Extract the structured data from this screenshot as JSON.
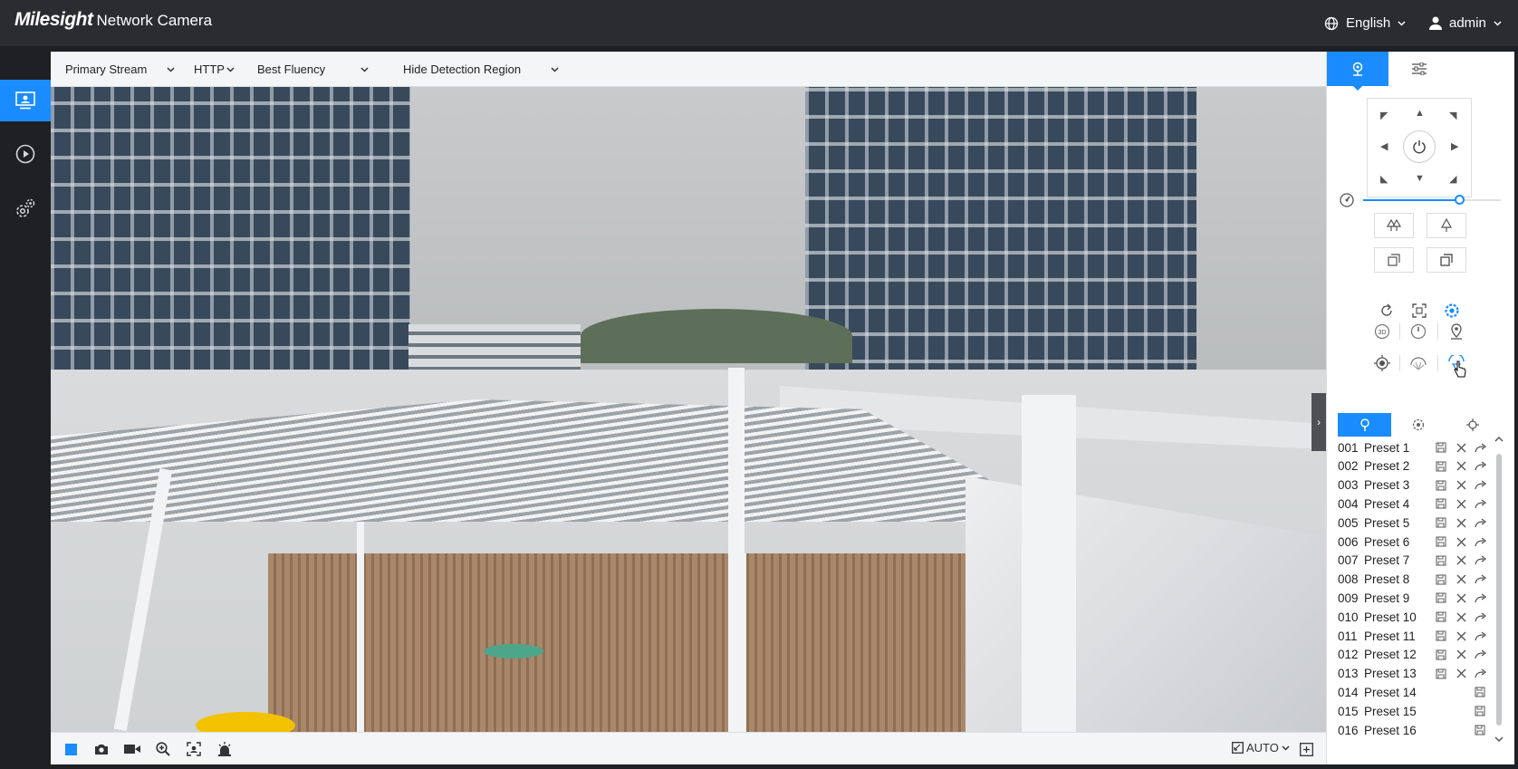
{
  "header": {
    "brand": "Milesight",
    "product": "Network Camera",
    "language": "English",
    "user": "admin"
  },
  "sidebar": {
    "items": [
      {
        "name": "live-view",
        "icon": "monitor-icon",
        "active": true
      },
      {
        "name": "playback",
        "icon": "play-icon",
        "active": false
      },
      {
        "name": "settings",
        "icon": "gear-icon",
        "active": false
      }
    ]
  },
  "toolbar": {
    "stream": "Primary Stream",
    "protocol": "HTTP",
    "fluency": "Best Fluency",
    "detection": "Hide Detection Region"
  },
  "bottom": {
    "icons": [
      "stop-icon",
      "snapshot-icon",
      "record-icon",
      "zoom-in-icon",
      "face-capture-icon",
      "alarm-icon"
    ],
    "ratio": "AUTO"
  },
  "ptz": {
    "tabs": [
      "ptz-control",
      "image-settings"
    ],
    "speed": 0.7,
    "preset_tabs": [
      "preset",
      "patrol",
      "pattern"
    ]
  },
  "presets": [
    {
      "num": "001",
      "name": "Preset 1",
      "set": true
    },
    {
      "num": "002",
      "name": "Preset 2",
      "set": true
    },
    {
      "num": "003",
      "name": "Preset 3",
      "set": true
    },
    {
      "num": "004",
      "name": "Preset 4",
      "set": true
    },
    {
      "num": "005",
      "name": "Preset 5",
      "set": true
    },
    {
      "num": "006",
      "name": "Preset 6",
      "set": true
    },
    {
      "num": "007",
      "name": "Preset 7",
      "set": true
    },
    {
      "num": "008",
      "name": "Preset 8",
      "set": true
    },
    {
      "num": "009",
      "name": "Preset 9",
      "set": true
    },
    {
      "num": "010",
      "name": "Preset 10",
      "set": true
    },
    {
      "num": "011",
      "name": "Preset 11",
      "set": true
    },
    {
      "num": "012",
      "name": "Preset 12",
      "set": true
    },
    {
      "num": "013",
      "name": "Preset 13",
      "set": true
    },
    {
      "num": "014",
      "name": "Preset 14",
      "set": false
    },
    {
      "num": "015",
      "name": "Preset 15",
      "set": false
    },
    {
      "num": "016",
      "name": "Preset 16",
      "set": false
    }
  ],
  "colors": {
    "accent": "#1a8cff",
    "topbar": "#2b2c30"
  }
}
